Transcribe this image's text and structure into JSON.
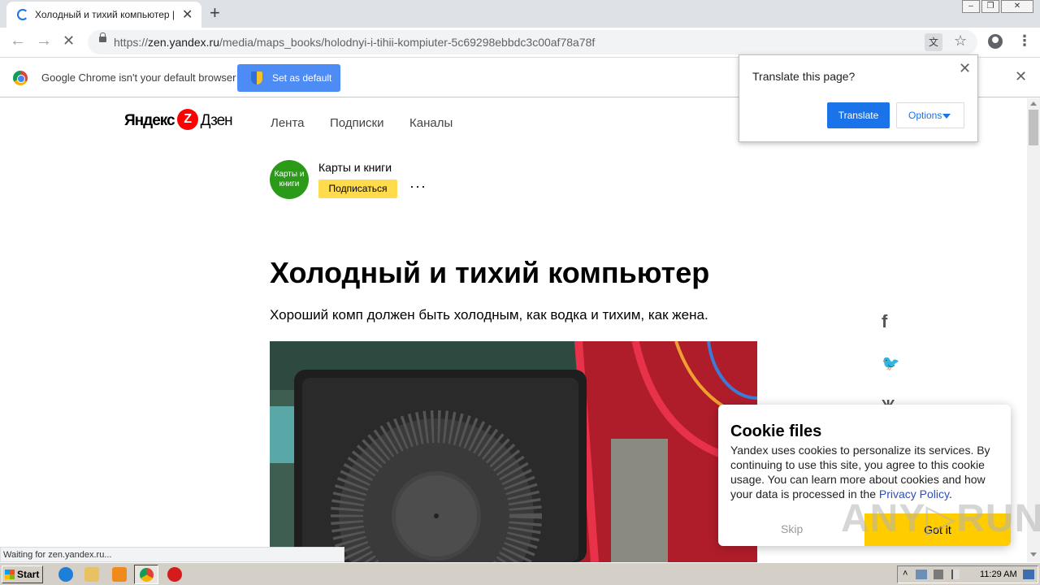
{
  "browser": {
    "tab_title": "Холодный и тихий компьютер | Ка",
    "tab_close": "✕",
    "new_tab": "+",
    "window_buttons": [
      "‒",
      "❐",
      "✕"
    ],
    "url_prefix": "https://",
    "url_domain": "zen.yandex.ru",
    "url_path": "/media/maps_books/holodnyi-i-tihii-kompiuter-5c69298ebbdc3c00af78a78f",
    "nav_back": "←",
    "nav_forward": "→",
    "nav_stop": "✕",
    "translate_icon": "文",
    "star": "☆",
    "menu": "⋮"
  },
  "infobar": {
    "message": "Google Chrome isn't your default browser",
    "button": "Set as default",
    "close": "✕"
  },
  "translate_popup": {
    "question": "Translate this page?",
    "translate_button": "Translate",
    "options_button": "Options",
    "close": "✕"
  },
  "site": {
    "logo_left": "Яндекс",
    "logo_z": "Z",
    "logo_right": "Дзен",
    "nav": [
      "Лента",
      "Подписки",
      "Каналы"
    ],
    "channel_avatar_text": "Карты и книги",
    "channel_name": "Карты и книги",
    "subscribe": "Подписаться",
    "more": "···",
    "headline": "Холодный и тихий компьютер",
    "subheadline": "Хороший комп должен быть холодным, как водка и тихим, как жена.",
    "share_icons": [
      "f",
      "🐦",
      "Ж"
    ]
  },
  "cookie": {
    "title": "Cookie files",
    "text": "Yandex uses cookies to personalize its services. By continuing to use this site, you agree to this cookie usage. You can learn more about cookies and how your data is processed in the",
    "link": "Privacy Policy",
    "link_suffix": ".",
    "skip": "Skip",
    "got_it": "Got it"
  },
  "status_text": "Waiting for zen.yandex.ru...",
  "watermark": "ANY▷RUN",
  "taskbar": {
    "start": "Start",
    "clock": "11:29 AM"
  },
  "colors": {
    "accent_blue": "#1a73e8",
    "yandex_red": "#ff0000",
    "subscribe_yellow": "#ffdb4d",
    "channel_green": "#2a9a18",
    "cookie_yellow": "#ffcc00"
  }
}
